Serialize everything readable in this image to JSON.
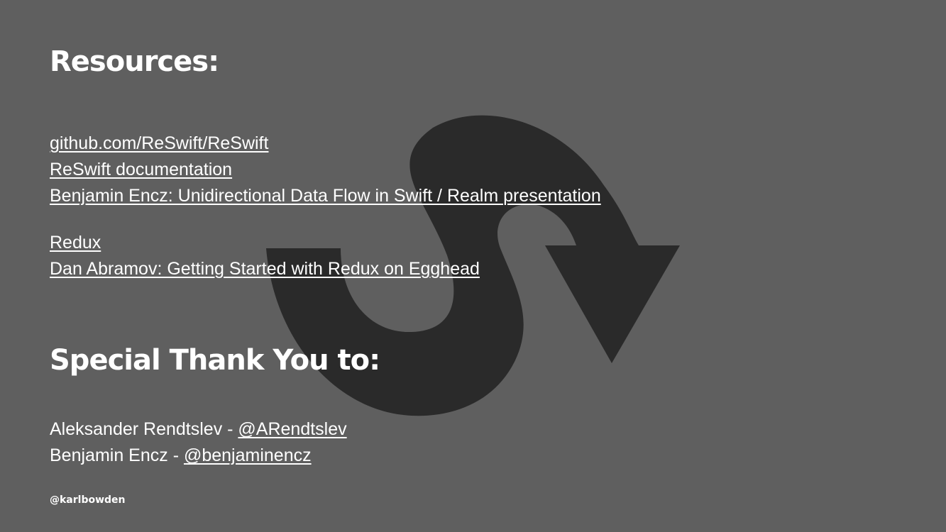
{
  "colors": {
    "background": "#5f5f5f",
    "logo": "#2a2a2a",
    "text": "#ffffff"
  },
  "resources": {
    "heading": "Resources:",
    "group1": [
      "github.com/ReSwift/ReSwift",
      "ReSwift documentation",
      "Benjamin Encz: Unidirectional Data Flow in Swift / Realm presentation"
    ],
    "group2": [
      "Redux",
      "Dan Abramov: Getting Started with Redux on Egghead"
    ]
  },
  "thanks": {
    "heading": "Special Thank You to:",
    "people": [
      {
        "name": "Aleksander Rendtslev - ",
        "handle": "@ARendtslev"
      },
      {
        "name": "Benjamin Encz - ",
        "handle": "@benjaminencz"
      }
    ]
  },
  "footer": {
    "handle": "@karlbowden"
  },
  "logo_icon": "reswift-arrow-icon"
}
